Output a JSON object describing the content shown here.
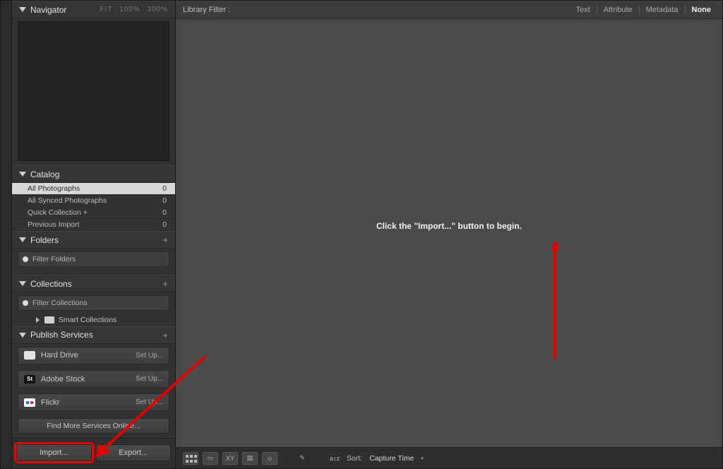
{
  "sidebar": {
    "navigator": {
      "title": "Navigator",
      "zoom": {
        "fit": "FIT",
        "p100": "100%",
        "p300": "300%"
      }
    },
    "catalog": {
      "title": "Catalog",
      "items": [
        {
          "label": "All Photographs",
          "count": "0",
          "selected": true
        },
        {
          "label": "All Synced Photographs",
          "count": "0",
          "selected": false
        },
        {
          "label": "Quick Collection  +",
          "count": "0",
          "selected": false
        },
        {
          "label": "Previous Import",
          "count": "0",
          "selected": false
        }
      ]
    },
    "folders": {
      "title": "Folders",
      "filter_placeholder": "Filter Folders"
    },
    "collections": {
      "title": "Collections",
      "filter_placeholder": "Filter Collections",
      "smart_label": "Smart Collections"
    },
    "publish": {
      "title": "Publish Services",
      "services": [
        {
          "name": "Hard Drive",
          "setup": "Set Up...",
          "icon": "hdd"
        },
        {
          "name": "Adobe Stock",
          "setup": "Set Up...",
          "icon": "St"
        },
        {
          "name": "Flickr",
          "setup": "Set Up...",
          "icon": "flk"
        }
      ],
      "find_more": "Find More Services Online..."
    },
    "bottom": {
      "import_label": "Import...",
      "export_label": "Export..."
    }
  },
  "library_filter": {
    "title": "Library Filter :",
    "options": {
      "text": "Text",
      "attribute": "Attribute",
      "metadata": "Metadata",
      "none": "None"
    },
    "selected": "None"
  },
  "main": {
    "hint": "Click the \"Import...\" button to begin."
  },
  "toolbar": {
    "sort_label": "Sort:",
    "sort_value": "Capture Time",
    "xy": "XY"
  },
  "annotation": {
    "arrow_color": "#e40000"
  }
}
